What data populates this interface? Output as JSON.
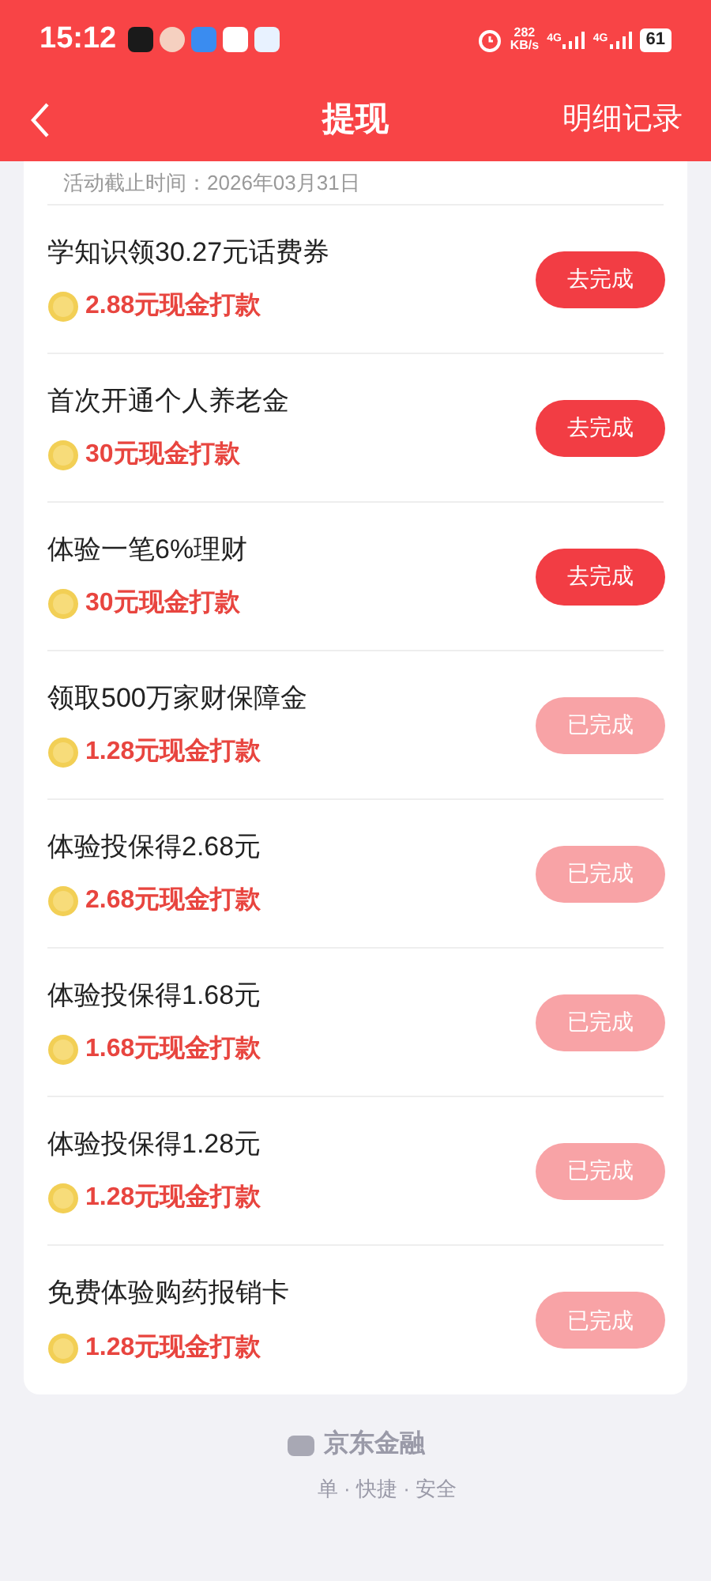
{
  "status_bar": {
    "time": "15:12",
    "speed_value": "282",
    "speed_unit": "KB/s",
    "network_1": "4G",
    "network_2": "4G",
    "battery": "61"
  },
  "header": {
    "title": "提现",
    "action": "明细记录"
  },
  "notice": "活动截止时间：2026年03月31日",
  "tasks": [
    {
      "title": "学知识领30.27元话费券",
      "reward": "2.88元现金打款",
      "button": "去完成",
      "done": false
    },
    {
      "title": "首次开通个人养老金",
      "reward": "30元现金打款",
      "button": "去完成",
      "done": false
    },
    {
      "title": "体验一笔6%理财",
      "reward": "30元现金打款",
      "button": "去完成",
      "done": false
    },
    {
      "title": "领取500万家财保障金",
      "reward": "1.28元现金打款",
      "button": "已完成",
      "done": true
    },
    {
      "title": "体验投保得2.68元",
      "reward": "2.68元现金打款",
      "button": "已完成",
      "done": true
    },
    {
      "title": "体验投保得1.68元",
      "reward": "1.68元现金打款",
      "button": "已完成",
      "done": true
    },
    {
      "title": "体验投保得1.28元",
      "reward": "1.28元现金打款",
      "button": "已完成",
      "done": true
    },
    {
      "title": "免费体验购药报销卡",
      "reward": "1.28元现金打款",
      "button": "已完成",
      "done": true
    }
  ],
  "footer": {
    "brand": "京东金融",
    "slogan": "单 · 快捷 · 安全"
  }
}
